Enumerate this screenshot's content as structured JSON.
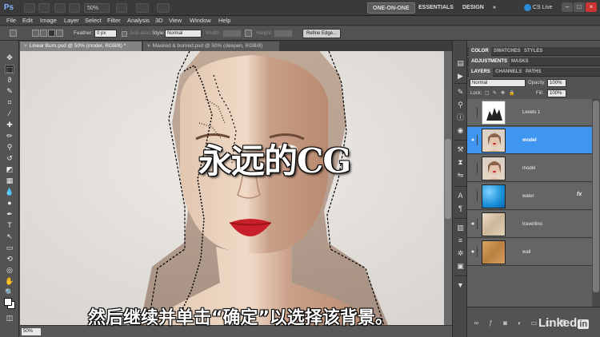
{
  "app": {
    "logo": "Ps",
    "zoom": "50%",
    "workspaces": [
      "ONE-ON-ONE",
      "ESSENTIALS",
      "DESIGN",
      "»"
    ],
    "cs_live": "CS Live",
    "window_controls": [
      "–",
      "□",
      "×"
    ]
  },
  "menu": [
    "File",
    "Edit",
    "Image",
    "Layer",
    "Select",
    "Filter",
    "Analysis",
    "3D",
    "View",
    "Window",
    "Help"
  ],
  "options": {
    "feather_label": "Feather:",
    "feather_value": "0 px",
    "antialias_label": "Anti-alias",
    "style_label": "Style:",
    "style_value": "Normal",
    "width_label": "Width:",
    "height_label": "Height:",
    "refine_edge": "Refine Edge..."
  },
  "documents": {
    "tabs": [
      {
        "title": "Linear Burn.psd @ 50% (model, RGB/8) *"
      },
      {
        "title": "Masked & burned.psd @ 50% (deepen, RGB/8)"
      }
    ]
  },
  "status": {
    "zoom": "50%"
  },
  "panels": {
    "group1_tabs": [
      "COLOR",
      "SWATCHES",
      "STYLES"
    ],
    "group2_tabs": [
      "ADJUSTMENTS",
      "MASKS"
    ],
    "group3_tabs": [
      "LAYERS",
      "CHANNELS",
      "PATHS"
    ],
    "blend_mode": "Normal",
    "opacity_label": "Opacity:",
    "opacity_value": "100%",
    "lock_label": "Lock:",
    "fill_label": "Fill:",
    "fill_value": "100%"
  },
  "layers": [
    {
      "name": "Levels 1",
      "visible": false,
      "selected": false,
      "fx": false
    },
    {
      "name": "model",
      "visible": true,
      "selected": true,
      "fx": false
    },
    {
      "name": "model",
      "visible": false,
      "selected": false,
      "fx": false
    },
    {
      "name": "water",
      "visible": false,
      "selected": false,
      "fx": true
    },
    {
      "name": "travertino",
      "visible": true,
      "selected": false,
      "fx": false
    },
    {
      "name": "wall",
      "visible": true,
      "selected": false,
      "fx": false
    }
  ],
  "layer_fx_label": "fx",
  "overlay": {
    "watermark": "永远的CG",
    "subtitle": "然后继续并单击“确定”以选择该背景。",
    "brand": "Linked",
    "brand_in": "in"
  },
  "colors": {
    "accent": "#3f96f0",
    "lips": "#c8202a"
  }
}
